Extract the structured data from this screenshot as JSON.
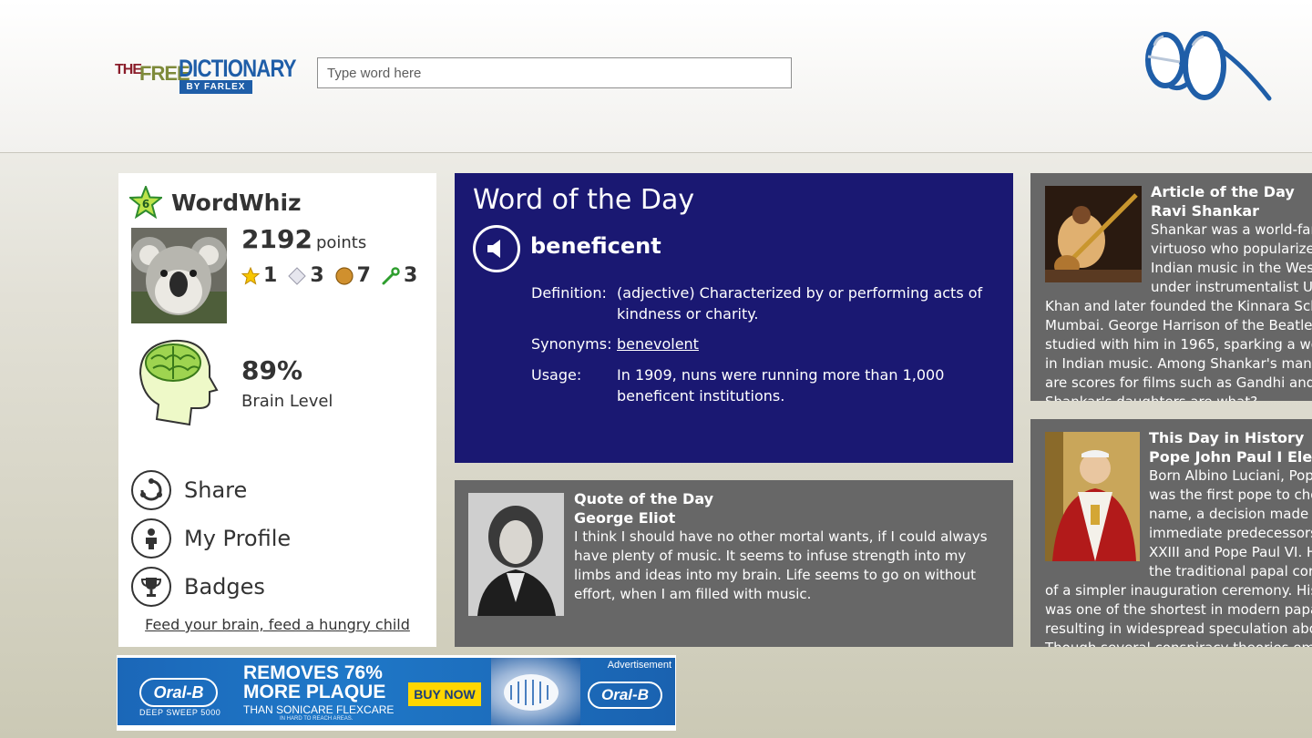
{
  "header": {
    "logo": {
      "the": "THE",
      "free": "FREE",
      "dictionary": "DICTIONARY",
      "byline": "BY FARLEX"
    },
    "search": {
      "placeholder": "Type word here",
      "value": ""
    }
  },
  "profile": {
    "level": "6",
    "username": "WordWhiz",
    "points": "2192",
    "points_label": "points",
    "stats": {
      "stars": "1",
      "diamonds": "3",
      "coins": "7",
      "keys": "3"
    },
    "brain_percent": "89%",
    "brain_label": "Brain Level",
    "menu": {
      "share": "Share",
      "profile": "My Profile",
      "badges": "Badges"
    },
    "feed_link": "Feed your brain, feed a hungry child"
  },
  "word_of_the_day": {
    "title": "Word of the Day",
    "word": "beneficent",
    "definition_label": "Definition:",
    "definition": "(adjective) Characterized by or performing acts of kindness or charity.",
    "synonyms_label": "Synonyms:",
    "synonyms": "benevolent",
    "usage_label": "Usage:",
    "usage": "In 1909, nuns were running more than 1,000 beneficent institutions."
  },
  "quote_of_the_day": {
    "title": "Quote of the Day",
    "author": "George Eliot",
    "text": "I think I should have no other mortal wants, if I could always have plenty of music. It seems to infuse strength into my limbs and ideas into my brain. Life seems to go on without effort, when I am filled with music."
  },
  "article_of_the_day": {
    "title": "Article of the Day",
    "subject": "Ravi Shankar",
    "text": "Shankar was a world-famous sitar virtuoso who popularized classical Indian music in the West. He trained under instrumentalist Ustad Allauddin Khan and later founded the Kinnara School of Music in Mumbai. George Harrison of the Beatles famously studied with him in 1965, sparking a worldwide interest in Indian music. Among Shankar's many compositions are scores for films such as Gandhi and Charly. Shankar's daughters are what?"
  },
  "this_day_in_history": {
    "title": "This Day in History",
    "subject": "Pope John Paul I Elevated",
    "text": "Born Albino Luciani, Pope John Paul I was the first pope to choose a double name, a decision made to honor his two immediate predecessors, Pope John XXIII and Pope Paul VI. He also declined the traditional papal coronation in favor of a simpler inauguration ceremony. His 33-day papacy was one of the shortest in modern papal history, resulting in widespread speculation about his death. Though several conspiracy theories emerged, what most likely killed him?"
  },
  "ad": {
    "label": "Advertisement",
    "brand": "Oral-B",
    "model": "DEEP SWEEP 5000",
    "headline_1": "REMOVES 76%",
    "headline_2": "MORE PLAQUE",
    "sub": "THAN SONICARE FLEXCARE",
    "fine_print": "IN HARD TO REACH AREAS.",
    "cta": "BUY NOW"
  },
  "colors": {
    "wotd_bg": "#1a1872",
    "card_bg": "#676767",
    "brand_blue": "#1f5ea8",
    "ad_blue": "#1b67b8",
    "buy_now": "#ffd600"
  },
  "icons": {
    "app_logo": "reading-glasses-icon",
    "level": "green-star-badge-icon",
    "stars": "gold-star-icon",
    "diamonds": "diamond-icon",
    "coins": "coin-icon",
    "keys": "key-icon",
    "brain": "brain-head-icon",
    "share": "share-icon",
    "profile": "person-icon",
    "badges": "trophy-icon",
    "audio": "speaker-icon"
  }
}
